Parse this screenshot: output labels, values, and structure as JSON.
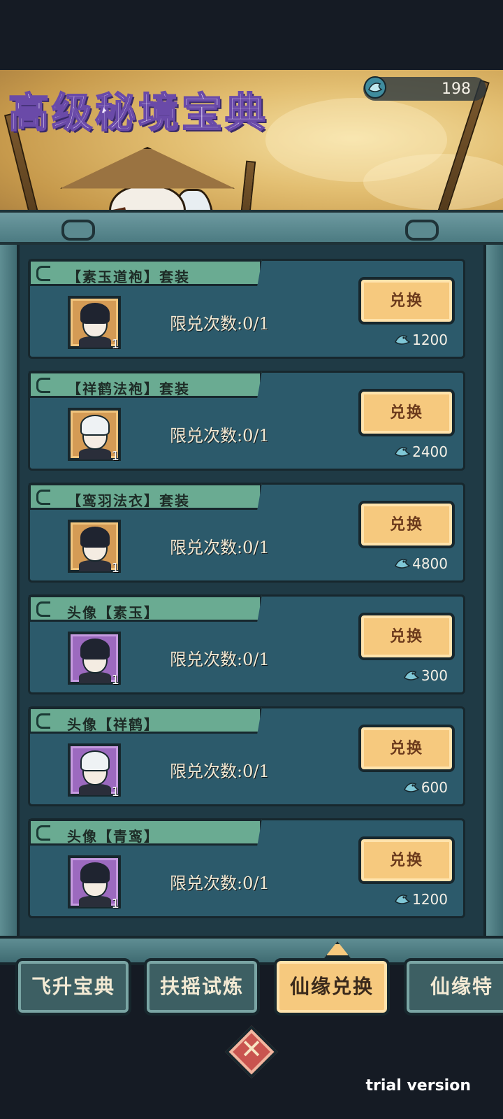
{
  "header": {
    "title": "高级秘境宝典",
    "currency_value": "198"
  },
  "items": [
    {
      "name": "【素玉道袍】套装",
      "limit": "限兑次数:0/1",
      "button": "兑换",
      "price": "1200",
      "qty": "1",
      "frame": "brown",
      "hair": "dark"
    },
    {
      "name": "【祥鹤法袍】套装",
      "limit": "限兑次数:0/1",
      "button": "兑换",
      "price": "2400",
      "qty": "1",
      "frame": "brown",
      "hair": "white"
    },
    {
      "name": "【鸾羽法衣】套装",
      "limit": "限兑次数:0/1",
      "button": "兑换",
      "price": "4800",
      "qty": "1",
      "frame": "brown",
      "hair": "dark"
    },
    {
      "name": "头像【素玉】",
      "limit": "限兑次数:0/1",
      "button": "兑换",
      "price": "300",
      "qty": "1",
      "frame": "purple",
      "hair": "dark"
    },
    {
      "name": "头像【祥鹤】",
      "limit": "限兑次数:0/1",
      "button": "兑换",
      "price": "600",
      "qty": "1",
      "frame": "purple",
      "hair": "white"
    },
    {
      "name": "头像【青鸾】",
      "limit": "限兑次数:0/1",
      "button": "兑换",
      "price": "1200",
      "qty": "1",
      "frame": "purple",
      "hair": "dark"
    }
  ],
  "tabs": [
    {
      "label": "飞升宝典",
      "active": false
    },
    {
      "label": "扶摇试炼",
      "active": false
    },
    {
      "label": "仙缘兑换",
      "active": true
    },
    {
      "label": "仙缘特",
      "active": false
    }
  ],
  "close_icon": "close-x-icon",
  "watermark": "trial version",
  "colors": {
    "accent_gold": "#f6c97e",
    "panel_teal": "#2c5a6b",
    "tag_green": "#6aab92",
    "close_red": "#c9544f"
  }
}
